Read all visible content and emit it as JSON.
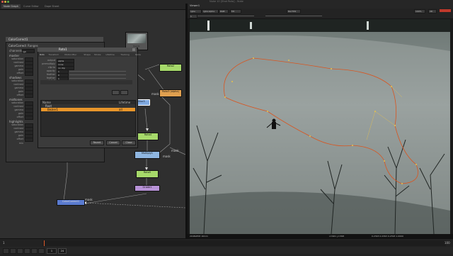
{
  "window": {
    "title": "Nuke 10 [Shot Roto] - Nuke"
  },
  "left_tabs": [
    "Node Graph",
    "Curve Editor",
    "Dope Sheet"
  ],
  "viewer_tabs": [
    "Viewer1"
  ],
  "viewer_toolbar": {
    "channels": "rgba",
    "layer": "rgba.alpha",
    "colorspace": "RGB",
    "gain": "f/8",
    "frame_label": "1",
    "proxy": "Rec709",
    "zoom": "100%",
    "display": "2D"
  },
  "viewer_info": {
    "format": "2048x858  16mm",
    "coords": "x=961 y=398",
    "frame_info": "0.2393  0.2393  0.2393  1.0000"
  },
  "properties": {
    "title": "Roto1",
    "tabs": [
      "Roto",
      "Transform",
      "Motion Blur",
      "Shape",
      "Stroke",
      "Lifetime",
      "Tracking",
      "Node"
    ],
    "rows": [
      {
        "label": "output",
        "value": "alpha"
      },
      {
        "label": "premultiply",
        "value": "none"
      },
      {
        "label": "clip to",
        "value": "no clip"
      },
      {
        "label": "opacity",
        "value": "1"
      },
      {
        "label": "feather",
        "value": "0"
      },
      {
        "label": "feather falloff",
        "value": "1"
      },
      {
        "label": "source",
        "value": ""
      }
    ],
    "curves_header": [
      "Name",
      "Lifetime"
    ],
    "curves": [
      {
        "name": "Root",
        "lifetime": ""
      },
      {
        "name": "Bezier1",
        "lifetime": "all"
      }
    ],
    "buttons": [
      "Revert",
      "Cancel",
      "Close"
    ]
  },
  "color_panel": {
    "title": "ColorCorrect1",
    "tabs": [
      "ColorCorrect",
      "Ranges",
      "Node"
    ],
    "channels_label": "channels",
    "channels_value": "rgb",
    "sections": [
      "master",
      "shadows",
      "midtones",
      "highlights"
    ],
    "rows": [
      "saturation",
      "contrast",
      "gamma",
      "gain",
      "offset"
    ],
    "mix_label": "mix"
  },
  "nodes": [
    {
      "label": "Read1\nmask",
      "color": "#b0b0b0"
    },
    {
      "label": "Roto2",
      "color": "#a6d96a"
    },
    {
      "label": "Roto3 (alpha)",
      "color": "#e0a050"
    },
    {
      "label": "Blur3",
      "color": "#7fa9e0"
    },
    {
      "label": "Roto4",
      "color": "#a6d96a"
    },
    {
      "label": "Multiply1",
      "color": "#8fb6e0"
    },
    {
      "label": "Roto5",
      "color": "#a6d96a"
    },
    {
      "label": "Grade1",
      "color": "#b792d6"
    },
    {
      "label": "ColorCorrect1",
      "color": "#5a7bd0"
    }
  ],
  "edge_labels": {
    "mask1": "mask",
    "mask2": "mask",
    "mask3": "mask",
    "mask4": "mask"
  },
  "timeline": {
    "start": "1",
    "end": "100",
    "current": "1",
    "fps": "24"
  },
  "colors": {
    "roto_curve": "#d9551f",
    "roto_points": "#e8c24a",
    "node_selected": "#ffffff"
  }
}
